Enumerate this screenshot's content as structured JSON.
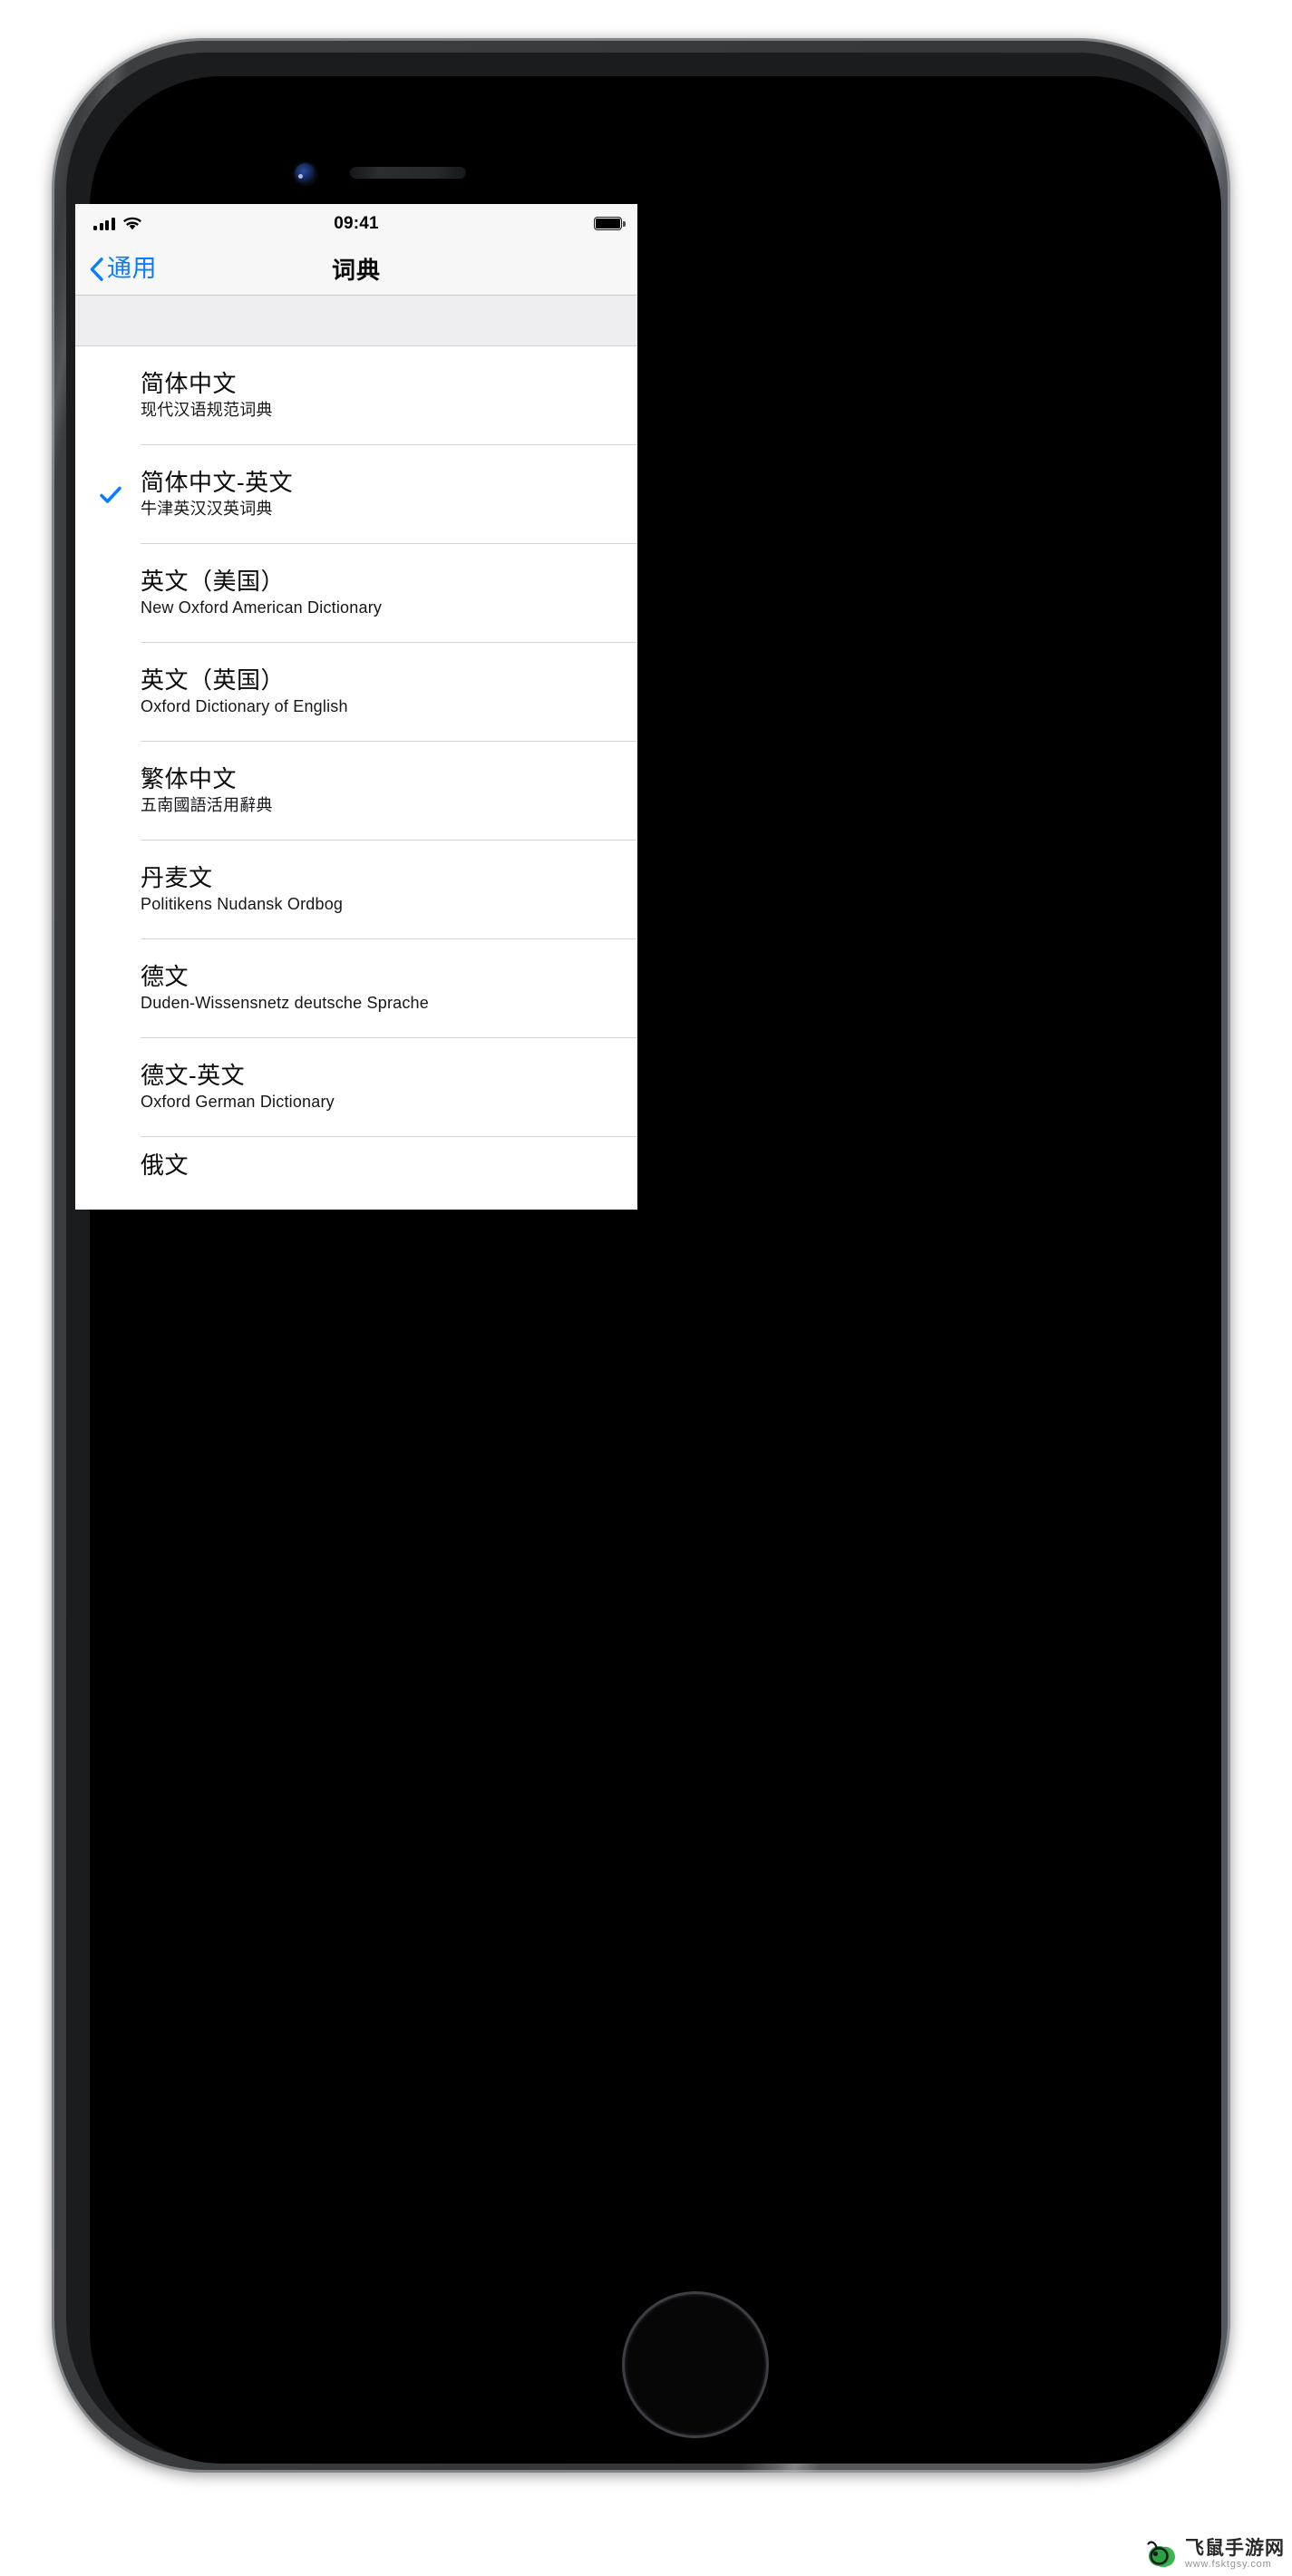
{
  "device": {
    "name": "iphone-space-gray",
    "frame_color": "#46494c",
    "screen_bg": "#ffffff"
  },
  "status_bar": {
    "signal_icon": "cellular-signal-icon",
    "signal_bars_filled": 4,
    "wifi_icon": "wifi-icon",
    "time": "09:41",
    "battery_icon": "battery-full-icon",
    "battery_level_percent": 100
  },
  "nav_bar": {
    "back_icon": "chevron-left-icon",
    "back_label": "通用",
    "title": "词典",
    "accent_color": "#0a7cff"
  },
  "section": {
    "header_label": "",
    "header_bg": "#eeeef2"
  },
  "list": {
    "checkmark_icon": "checkmark-icon",
    "checkmark_color": "#0a7cff",
    "items": [
      {
        "title": "简体中文",
        "subtitle": "现代汉语规范词典",
        "selected": false
      },
      {
        "title": "简体中文-英文",
        "subtitle": "牛津英汉汉英词典",
        "selected": true
      },
      {
        "title": "英文（美国）",
        "subtitle": "New Oxford American Dictionary",
        "selected": false
      },
      {
        "title": "英文（英国）",
        "subtitle": "Oxford Dictionary of English",
        "selected": false
      },
      {
        "title": "繁体中文",
        "subtitle": "五南國語活用辭典",
        "selected": false
      },
      {
        "title": "丹麦文",
        "subtitle": "Politikens Nudansk Ordbog",
        "selected": false
      },
      {
        "title": "德文",
        "subtitle": "Duden-Wissensnetz deutsche Sprache",
        "selected": false
      },
      {
        "title": "德文-英文",
        "subtitle": "Oxford German Dictionary",
        "selected": false
      },
      {
        "title": "俄文",
        "subtitle": "",
        "selected": false
      }
    ]
  },
  "watermark": {
    "icon": "mouse-icon",
    "icon_color": "#2eae46",
    "brand": "飞鼠手游网",
    "url": "www.fsktgsy.com"
  }
}
